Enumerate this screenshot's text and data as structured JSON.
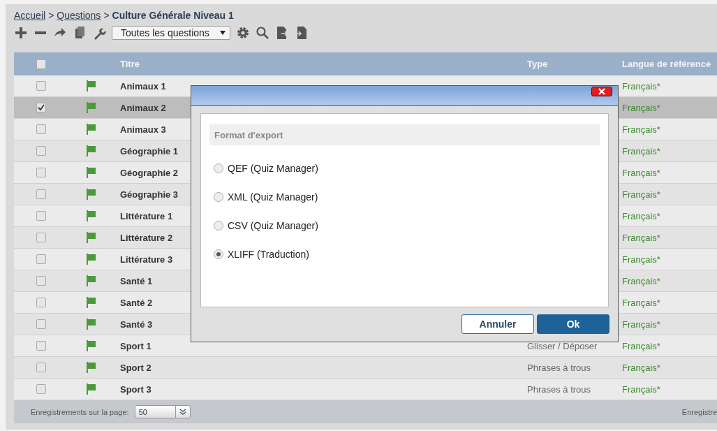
{
  "breadcrumb": [
    {
      "label": "Accueil",
      "kind": "link"
    },
    {
      "label": "Questions",
      "kind": "link"
    },
    {
      "label": "Culture Générale Niveau 1",
      "kind": "current"
    }
  ],
  "breadcrumb_separator": ">",
  "toolbar": {
    "filter": "Toutes les questions"
  },
  "table": {
    "header_checked": false,
    "columns": [
      "Titre",
      "Type",
      "Langue de référence"
    ],
    "rows": [
      {
        "title": "Animaux 1",
        "language": "Français*",
        "checked": false
      },
      {
        "title": "Animaux 2",
        "language": "Français*",
        "checked": true
      },
      {
        "title": "Animaux 3",
        "language": "Français*",
        "checked": false
      },
      {
        "title": "Géographie 1",
        "language": "Français*",
        "checked": false
      },
      {
        "title": "Géographie 2",
        "language": "Français*",
        "checked": false
      },
      {
        "title": "Géographie 3",
        "language": "Français*",
        "checked": false
      },
      {
        "title": "Littérature 1",
        "language": "Français*",
        "checked": false
      },
      {
        "title": "Littérature 2",
        "language": "Français*",
        "checked": false
      },
      {
        "title": "Littérature 3",
        "language": "Français*",
        "checked": false
      },
      {
        "title": "Santé 1",
        "language": "Français*",
        "checked": false
      },
      {
        "title": "Santé 2",
        "language": "Français*",
        "checked": false
      },
      {
        "title": "Santé 3",
        "language": "Français*",
        "checked": false
      },
      {
        "title": "Sport 1",
        "type": "Glisser / Déposer",
        "language": "Français*",
        "checked": false
      },
      {
        "title": "Sport 2",
        "type": "Phrases à trous",
        "language": "Français*",
        "checked": false
      },
      {
        "title": "Sport 3",
        "type": "Phrases à trous",
        "language": "Français*",
        "checked": false
      }
    ]
  },
  "footer": {
    "label": "Enregistrements sur la page:",
    "page_size": "50",
    "right_text": "Enregistre"
  },
  "dialog": {
    "section_title": "Format d'export",
    "options": [
      {
        "label": "QEF (Quiz Manager)",
        "selected": false
      },
      {
        "label": "XML (Quiz Manager)",
        "selected": false
      },
      {
        "label": "CSV (Quiz Manager)",
        "selected": false
      },
      {
        "label": "XLIFF (Traduction)",
        "selected": true
      }
    ],
    "buttons": [
      {
        "label": "Annuler",
        "kind": "secondary"
      },
      {
        "label": "Ok",
        "kind": "primary"
      }
    ]
  }
}
